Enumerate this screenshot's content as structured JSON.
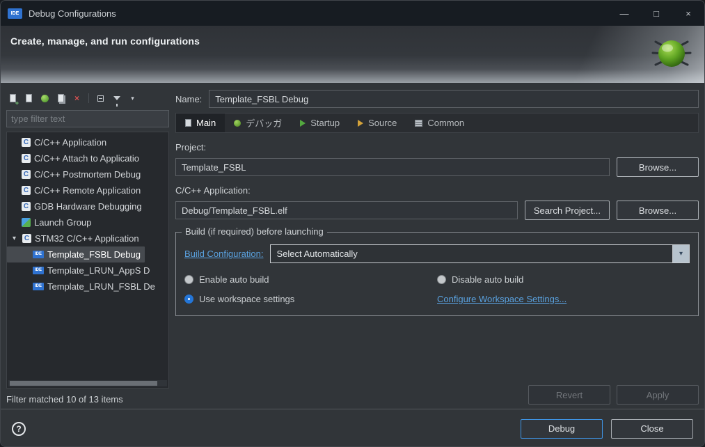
{
  "window": {
    "badge": "IDE",
    "title": "Debug Configurations",
    "minimize": "—",
    "maximize": "□",
    "close": "×"
  },
  "banner": {
    "title": "Create, manage, and run configurations"
  },
  "sidebar": {
    "filter_placeholder": "type filter text",
    "status": "Filter matched 10 of 13 items",
    "tree": [
      {
        "label": "C/C++ Application"
      },
      {
        "label": "C/C++ Attach to Applicatio"
      },
      {
        "label": "C/C++ Postmortem Debug"
      },
      {
        "label": "C/C++ Remote Application"
      },
      {
        "label": "GDB Hardware Debugging"
      },
      {
        "label": "Launch Group"
      },
      {
        "label": "STM32 C/C++ Application"
      },
      {
        "label": "Template_FSBL Debug"
      },
      {
        "label": "Template_LRUN_AppS D"
      },
      {
        "label": "Template_LRUN_FSBL De"
      }
    ]
  },
  "form": {
    "name_label": "Name:",
    "name_value": "Template_FSBL Debug",
    "tabs": [
      {
        "label": "Main"
      },
      {
        "label": "デバッガ"
      },
      {
        "label": "Startup"
      },
      {
        "label": "Source"
      },
      {
        "label": "Common"
      }
    ],
    "project_label": "Project:",
    "project_value": "Template_FSBL",
    "project_browse": "Browse...",
    "application_label": "C/C++ Application:",
    "application_value": "Debug/Template_FSBL.elf",
    "search_project": "Search Project...",
    "application_browse": "Browse...",
    "build_group": {
      "title": "Build (if required) before launching",
      "config_link": "Build Configuration:",
      "config_value": "Select Automatically",
      "enable_auto": "Enable auto build",
      "disable_auto": "Disable auto build",
      "use_workspace": "Use workspace settings",
      "configure_link": "Configure Workspace Settings..."
    },
    "revert": "Revert",
    "apply": "Apply"
  },
  "footer": {
    "debug": "Debug",
    "close": "Close"
  },
  "icons": {
    "c_badge": "C",
    "ide_badge": "IDE",
    "expander_open": "▾",
    "combo_chevron": "▾",
    "menu_chevron": "▾",
    "delete_x": "×",
    "help": "?"
  },
  "colors": {
    "accent_blue": "#3f94e4",
    "link_blue": "#5aa2e0",
    "selection_blue": "#2476d8"
  }
}
